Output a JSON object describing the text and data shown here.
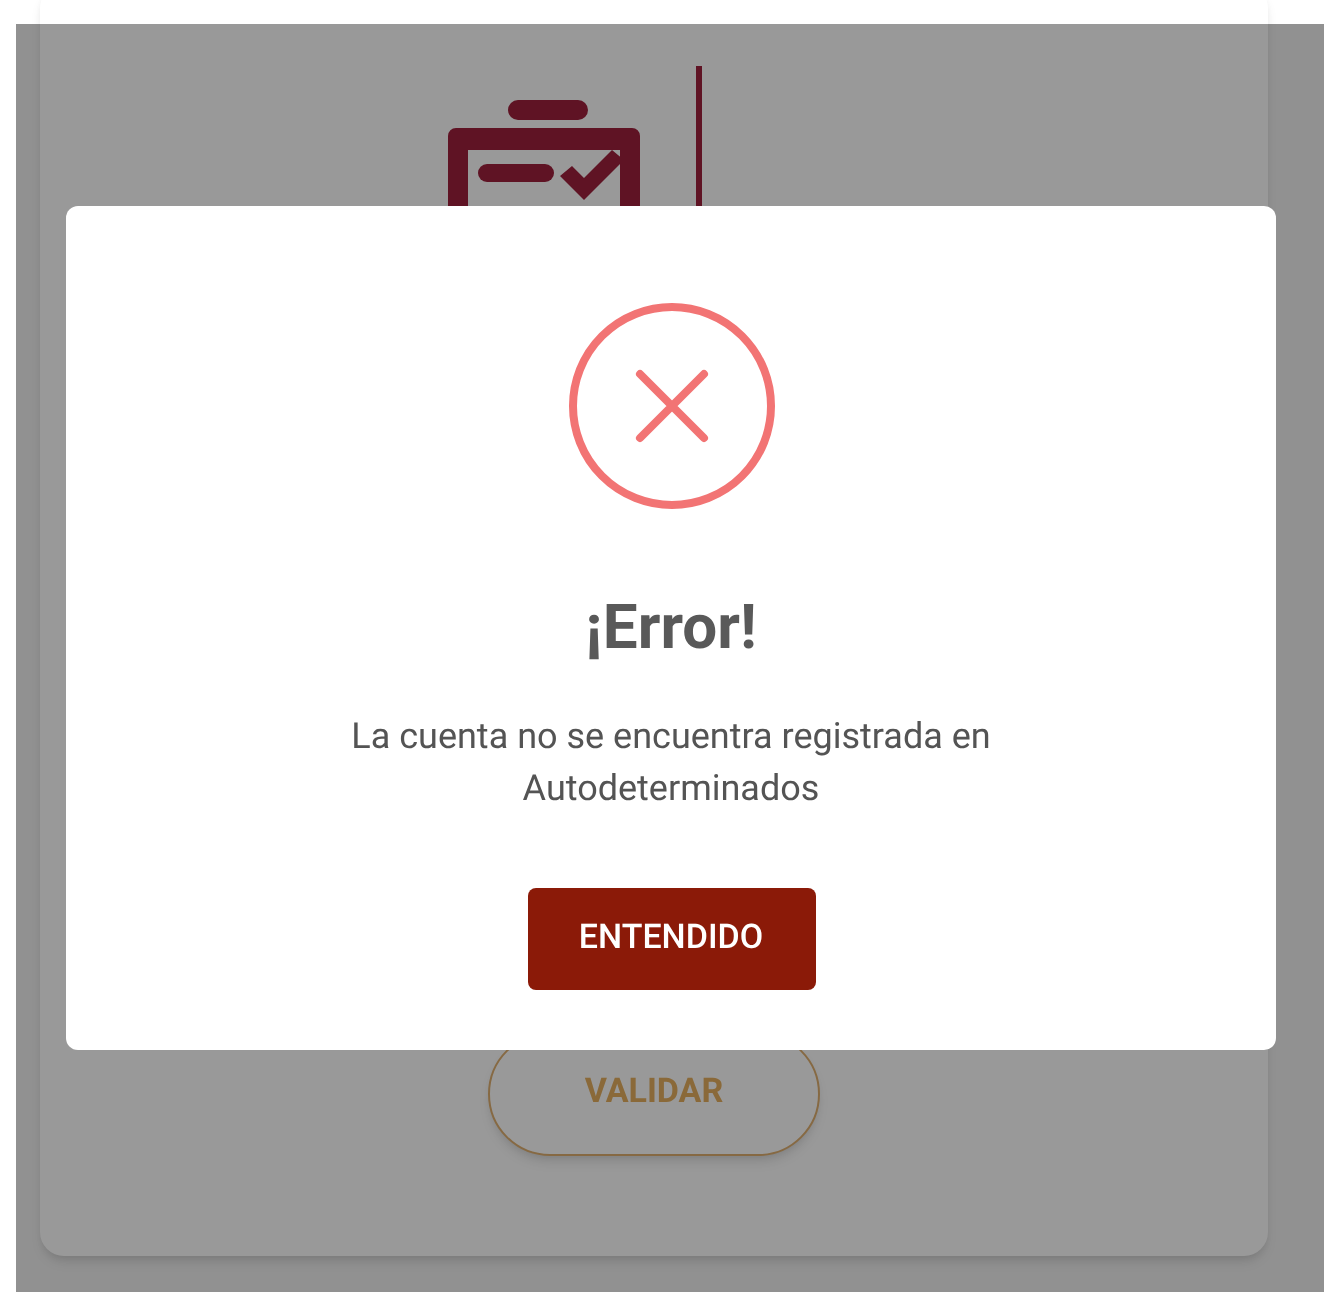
{
  "background": {
    "validate_button": "VALIDAR"
  },
  "dialog": {
    "kind": "error",
    "title": "¡Error!",
    "message": "La cuenta no se encuentra registrada en Autodeterminados",
    "button": "ENTENDIDO"
  }
}
